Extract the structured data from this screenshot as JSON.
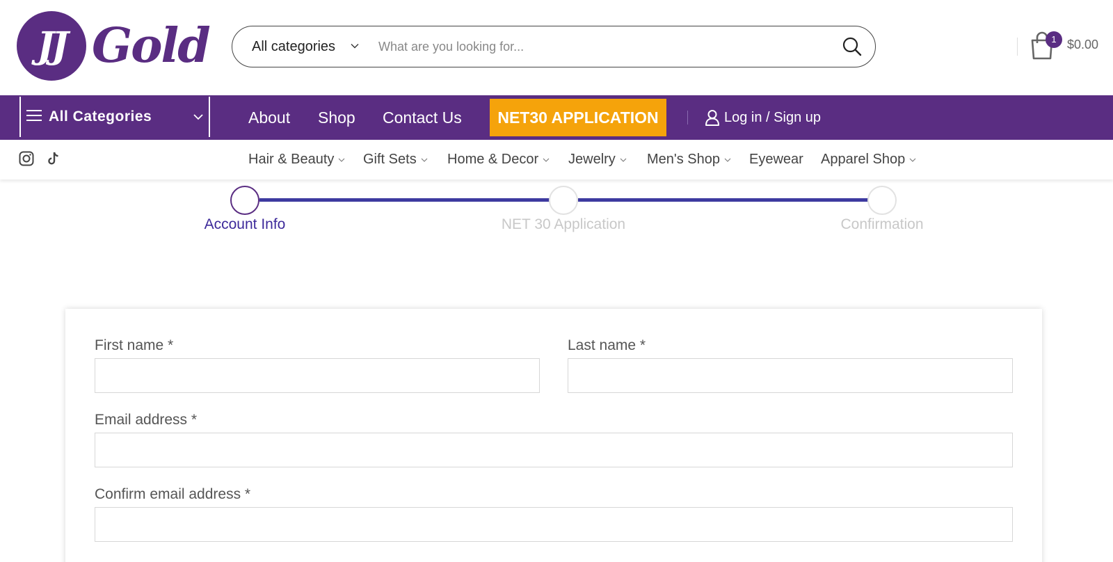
{
  "logo": {
    "initials": "JJ",
    "wordmark": "Gold"
  },
  "search": {
    "category_label": "All categories",
    "placeholder": "What are you looking for..."
  },
  "cart": {
    "count": "1",
    "total": "$0.00"
  },
  "navbar": {
    "all_categories": "All Categories",
    "links": [
      "About",
      "Shop",
      "Contact Us"
    ],
    "cta": "NET30 APPLICATION",
    "login": "Log in / Sign up"
  },
  "subnav": {
    "items": [
      {
        "label": "Hair & Beauty",
        "has_dropdown": true
      },
      {
        "label": "Gift Sets",
        "has_dropdown": true
      },
      {
        "label": "Home & Decor",
        "has_dropdown": true
      },
      {
        "label": "Jewelry",
        "has_dropdown": true
      },
      {
        "label": "Men's Shop",
        "has_dropdown": true
      },
      {
        "label": "Eyewear",
        "has_dropdown": false
      },
      {
        "label": "Apparel Shop",
        "has_dropdown": true
      }
    ],
    "social_icons": [
      "instagram-icon",
      "tiktok-icon"
    ]
  },
  "steps": [
    {
      "label": "Account Info",
      "active": true
    },
    {
      "label": "NET 30 Application",
      "active": false
    },
    {
      "label": "Confirmation",
      "active": false
    }
  ],
  "form": {
    "first_name_label": "First name *",
    "first_name_value": "",
    "last_name_label": "Last name *",
    "last_name_value": "",
    "email_label": "Email address *",
    "email_value": "",
    "confirm_email_label": "Confirm email address *",
    "confirm_email_value": ""
  },
  "colors": {
    "brand_purple": "#5a2d82",
    "cta_orange": "#f5a30b",
    "step_active": "#3d2a9a",
    "step_inactive": "#c8c8c8"
  }
}
